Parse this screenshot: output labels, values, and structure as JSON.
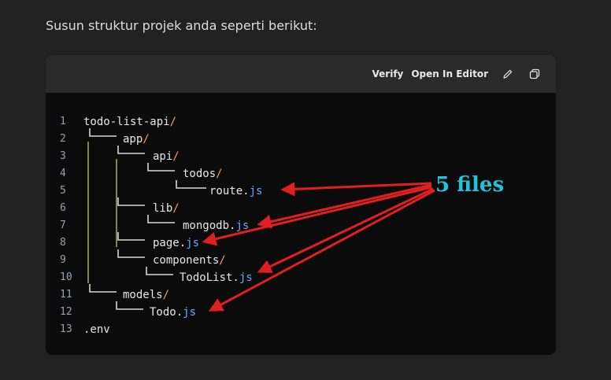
{
  "intro_text": "Susun struktur projek anda seperti berikut:",
  "toolbar": {
    "verify_label": "Verify",
    "open_editor_label": "Open In Editor",
    "edit_icon": "pencil-icon",
    "copy_icon": "copy-icon"
  },
  "code_lines": [
    {
      "n": "1",
      "name": "todo-list-api",
      "suffix": "/",
      "ext": ""
    },
    {
      "n": "2",
      "name": "app",
      "suffix": "/",
      "ext": ""
    },
    {
      "n": "3",
      "name": "api",
      "suffix": "/",
      "ext": ""
    },
    {
      "n": "4",
      "name": "todos",
      "suffix": "/",
      "ext": ""
    },
    {
      "n": "5",
      "name": "route.",
      "suffix": "",
      "ext": "js"
    },
    {
      "n": "6",
      "name": "lib",
      "suffix": "/",
      "ext": ""
    },
    {
      "n": "7",
      "name": "mongodb.",
      "suffix": "",
      "ext": "js"
    },
    {
      "n": "8",
      "name": "page.",
      "suffix": "",
      "ext": "js"
    },
    {
      "n": "9",
      "name": "components",
      "suffix": "/",
      "ext": ""
    },
    {
      "n": "10",
      "name": "TodoList.",
      "suffix": "",
      "ext": "js"
    },
    {
      "n": "11",
      "name": "models",
      "suffix": "/",
      "ext": ""
    },
    {
      "n": "12",
      "name": "Todo.",
      "suffix": "",
      "ext": "js"
    },
    {
      "n": "13",
      "name": ".env",
      "suffix": "",
      "ext": ""
    }
  ],
  "annotation": {
    "label": "5 files",
    "color": "#1ec3dc",
    "arrow_color": "#e02020"
  }
}
